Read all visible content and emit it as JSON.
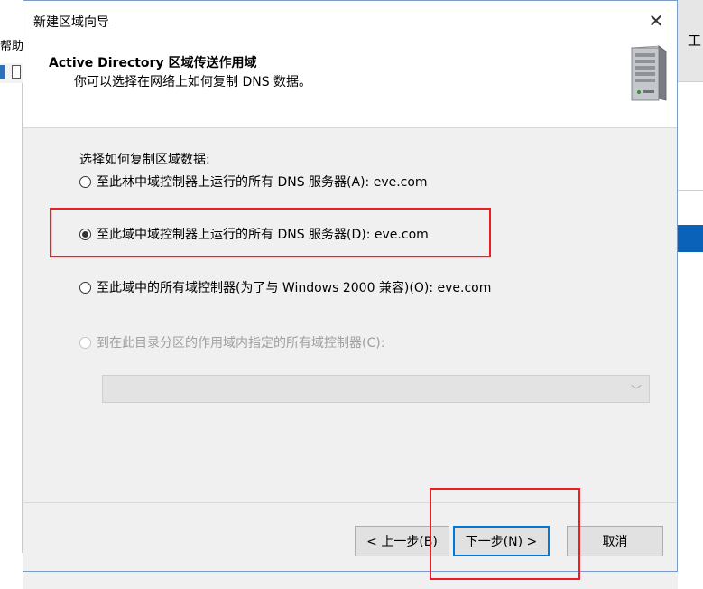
{
  "background": {
    "left_menu_label": "帮助",
    "right_header_label": "工"
  },
  "dialog": {
    "title": "新建区域向导",
    "close_glyph": "✕",
    "header": {
      "title": "Active Directory 区域传送作用域",
      "subtitle": "你可以选择在网络上如何复制 DNS 数据。",
      "icon": "server-icon"
    },
    "prompt": "选择如何复制区域数据:",
    "options": [
      {
        "label": "至此林中域控制器上运行的所有 DNS 服务器(A): eve.com",
        "checked": false,
        "enabled": true
      },
      {
        "label": "至此域中域控制器上运行的所有 DNS 服务器(D): eve.com",
        "checked": true,
        "enabled": true
      },
      {
        "label": "至此域中的所有域控制器(为了与 Windows 2000 兼容)(O): eve.com",
        "checked": false,
        "enabled": true
      },
      {
        "label": "到在此目录分区的作用域内指定的所有域控制器(C):",
        "checked": false,
        "enabled": false
      }
    ],
    "partition_select": {
      "value": "",
      "enabled": false
    },
    "buttons": {
      "back": "< 上一步(B)",
      "next": "下一步(N) >",
      "cancel": "取消"
    }
  },
  "colors": {
    "highlight_red": "#ee1c25",
    "default_button_border": "#0078d7",
    "selection_blue": "#0a63b8"
  }
}
